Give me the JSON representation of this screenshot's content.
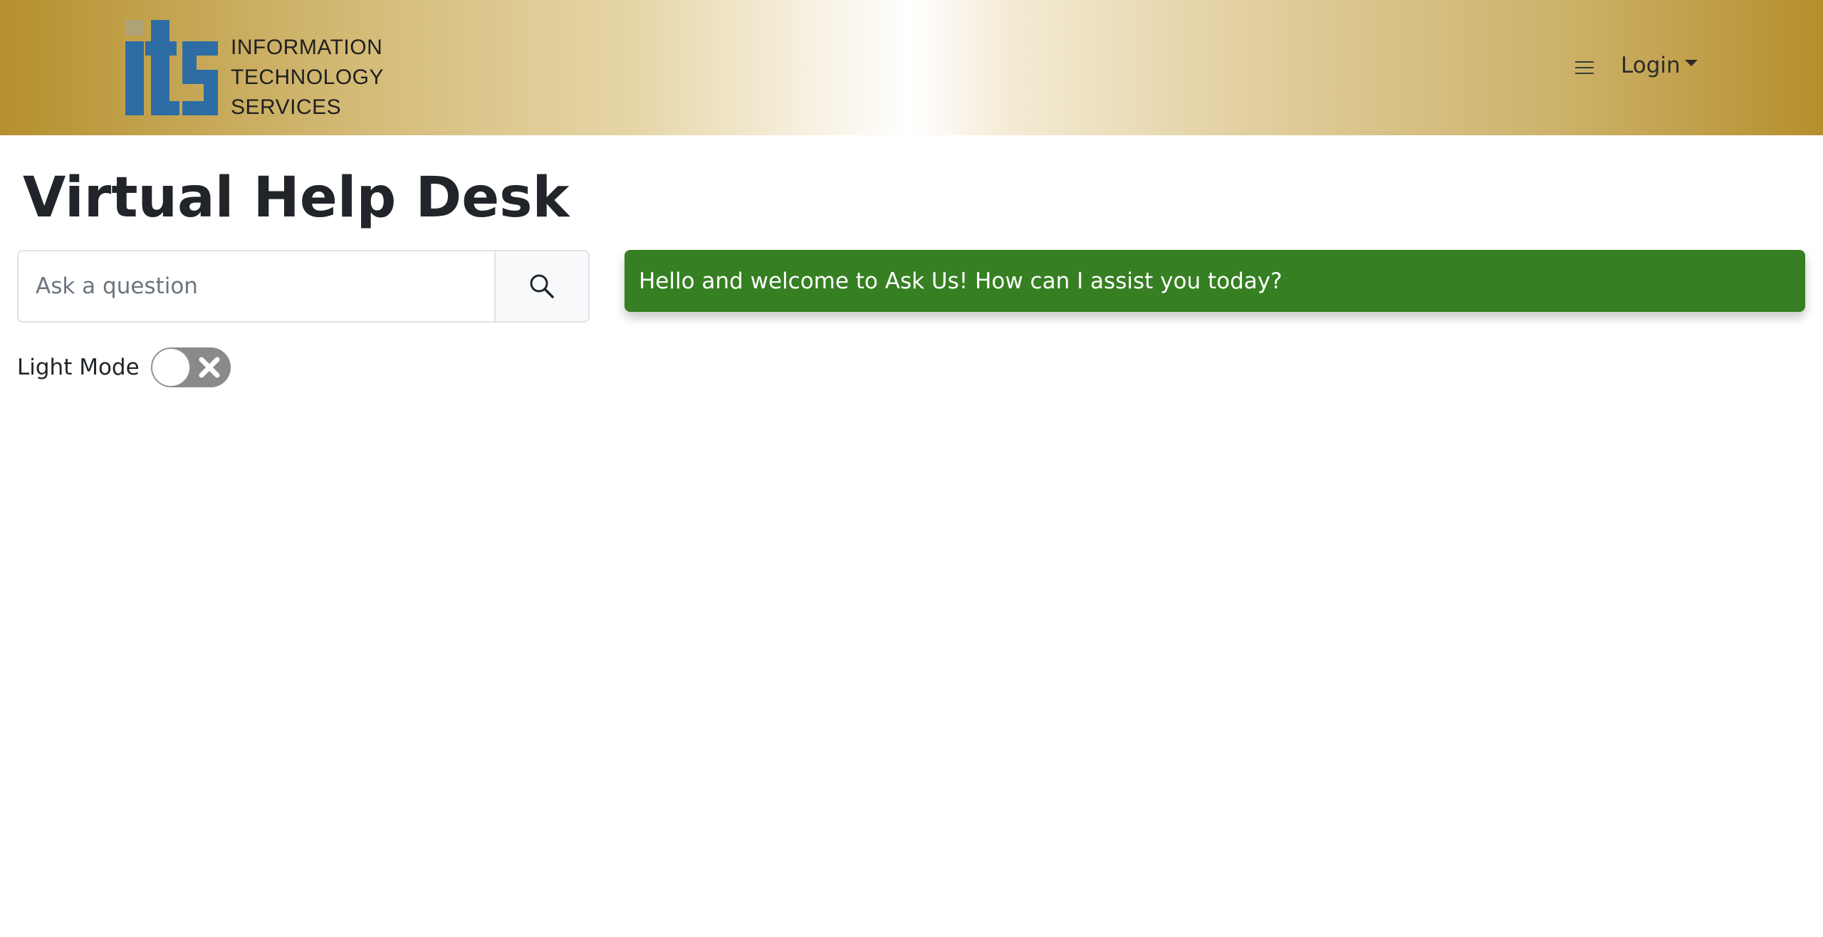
{
  "header": {
    "logo": {
      "mark": "its",
      "lines": [
        "INFORMATION",
        "TECHNOLOGY",
        "SERVICES"
      ]
    },
    "menu_icon": "hamburger-icon",
    "login_label": "Login"
  },
  "main": {
    "title": "Virtual Help Desk",
    "search": {
      "placeholder": "Ask a question",
      "value": "",
      "button_icon": "search-icon"
    },
    "mode_toggle": {
      "label": "Light Mode",
      "state": "off"
    },
    "welcome_message": "Hello and welcome to Ask Us! How can I assist you today?"
  },
  "colors": {
    "header_gold": "#b5902e",
    "logo_blue": "#2e6da4",
    "welcome_green": "#367f22",
    "toggle_gray": "#8a8a8a"
  }
}
